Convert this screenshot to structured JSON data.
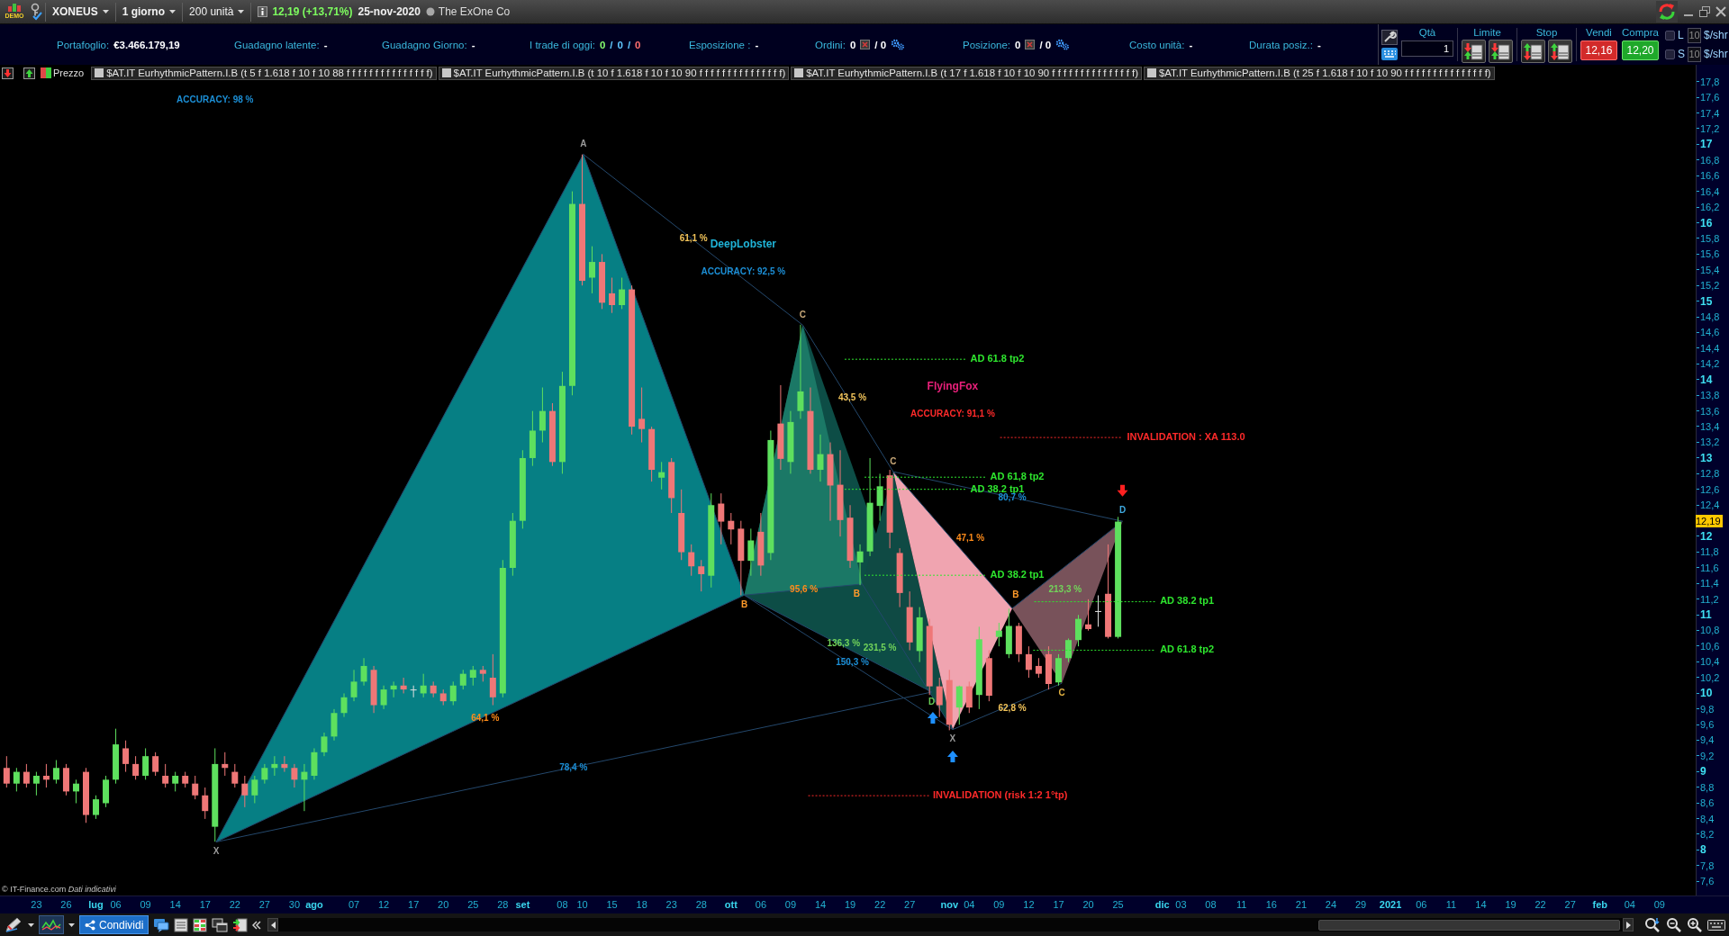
{
  "title_bar": {
    "demo_badge": "DEMO",
    "symbol": "XONEUS",
    "timeframe": "1 giorno",
    "units": "200 unità",
    "quote": "12,19 (+13,71%)",
    "date": "25-nov-2020",
    "company": "The ExOne Co"
  },
  "account_bar": {
    "stats": [
      {
        "kind": "value",
        "label": "Portafoglio:",
        "value": "€3.466.179,19"
      },
      {
        "kind": "value",
        "label": "Guadagno latente:",
        "value": "-"
      },
      {
        "kind": "value",
        "label": "Guadagno Giorno:",
        "value": "-"
      },
      {
        "kind": "counts",
        "label": "I trade di oggi:",
        "parts": [
          {
            "text": "0",
            "color": "#86ff6e"
          },
          {
            "text": "/",
            "color": "#5fc8ff"
          },
          {
            "text": "0",
            "color": "#5fc8ff"
          },
          {
            "text": "/",
            "color": "#5fc8ff"
          },
          {
            "text": "0",
            "color": "#ff6e6e"
          }
        ]
      },
      {
        "kind": "value",
        "label": "Esposizione :",
        "value": "-"
      },
      {
        "kind": "orders",
        "label": "Ordini:",
        "value": "0",
        "value_2": "/ 0"
      },
      {
        "kind": "orders",
        "label": "Posizione:",
        "value": "0",
        "value_2": "/ 0"
      },
      {
        "kind": "value",
        "label": "Costo unità:",
        "value": "-"
      },
      {
        "kind": "value",
        "label": "Durata posiz.:",
        "value": "-"
      }
    ]
  },
  "trade_panel": {
    "quantity": {
      "label": "Qtà",
      "value": "1"
    },
    "limit": {
      "label": "Limite"
    },
    "stop": {
      "label": "Stop"
    },
    "sell": {
      "label": "Vendi",
      "price": "12,16"
    },
    "buy": {
      "label": "Compra",
      "price": "12,20"
    },
    "sides": [
      {
        "label": "L",
        "checked": false,
        "amount": "10",
        "unit": "$/shr"
      },
      {
        "label": "S",
        "checked": false,
        "amount": "10",
        "unit": "$/shr"
      }
    ]
  },
  "legend": {
    "price": "Prezzo",
    "indicators": [
      "$AT.IT EurhythmicPattern.I.B (t 5 f 1.618 f 10 f 10 88 f f f f f f f f f f f f f f f)",
      "$AT.IT EurhythmicPattern.I.B (t 10 f 1.618 f 10 f 10 90 f f f f f f f f f f f f f f f)",
      "$AT.IT EurhythmicPattern.I.B (t 17 f 1.618 f 10 f 10 90 f f f f f f f f f f f f f f f)",
      "$AT.IT EurhythmicPattern.I.B (t 25 f 1.618 f 10 f 10 90 f f f f f f f f f f f f f f f)"
    ]
  },
  "chart": {
    "annotations": [
      {
        "text": "ACCURACY: 98 %",
        "kind": "label",
        "color": "#1c8fd6"
      },
      {
        "text": "61,1 %",
        "kind": "label",
        "color": "#f2c45a"
      },
      {
        "text": "DeepLobster",
        "kind": "title",
        "color": "#1fb4d8"
      },
      {
        "text": "ACCURACY: 92,5 %",
        "kind": "label",
        "color": "#1c8fd6"
      },
      {
        "text": "AD 61.8 tp2",
        "kind": "level",
        "color": "#2ee62e"
      },
      {
        "text": "FlyingFox",
        "kind": "title",
        "color": "#e8207a"
      },
      {
        "text": "43,5 %",
        "kind": "label",
        "color": "#f2c45a"
      },
      {
        "text": "ACCURACY: 91,1 %",
        "kind": "label",
        "color": "#ff2a2a"
      },
      {
        "text": "INVALIDATION : XA 113.0",
        "kind": "level",
        "color": "#ff2a2a"
      },
      {
        "text": "AD 61,8 tp2",
        "kind": "level",
        "color": "#2ee62e"
      },
      {
        "text": "AD 38.2 tp1",
        "kind": "level",
        "color": "#2ee62e"
      },
      {
        "text": "80,7 %",
        "kind": "label",
        "color": "#1c8fd6"
      },
      {
        "text": "47,1 %",
        "kind": "label",
        "color": "#ff8c1a"
      },
      {
        "text": "213,3 %",
        "kind": "label",
        "color": "#72d45a"
      },
      {
        "text": "AD 38.2 tp1",
        "kind": "level",
        "color": "#2ee62e"
      },
      {
        "text": "95,6 %",
        "kind": "label",
        "color": "#ff8c1a"
      },
      {
        "text": "AD 38.2 tp1",
        "kind": "level",
        "color": "#2ee62e"
      },
      {
        "text": "136,3 %",
        "kind": "label",
        "color": "#72d45a"
      },
      {
        "text": "AD 61.8 tp2",
        "kind": "level",
        "color": "#2ee62e"
      },
      {
        "text": "231,5 %",
        "kind": "label",
        "color": "#72d45a"
      },
      {
        "text": "150,3 %",
        "kind": "label",
        "color": "#1c8fd6"
      },
      {
        "text": "62,8 %",
        "kind": "label",
        "color": "#f2c45a"
      },
      {
        "text": "64,1 %",
        "kind": "label",
        "color": "#ff8c1a"
      },
      {
        "text": "78,4 %",
        "kind": "label",
        "color": "#1c8fd6"
      },
      {
        "text": "INVALIDATION (risk 1:2 1°tp)",
        "kind": "level",
        "color": "#ff2a2a"
      }
    ],
    "points": [
      {
        "label": "X",
        "color": "#9a9a9a"
      },
      {
        "label": "A",
        "color": "#9a9a9a"
      },
      {
        "label": "B",
        "color": "#ff9a2a"
      },
      {
        "label": "C",
        "color": "#c8a878"
      },
      {
        "label": "B",
        "color": "#ff9a2a"
      },
      {
        "label": "C",
        "color": "#c8a878"
      },
      {
        "label": "D",
        "color": "#66cc55"
      },
      {
        "label": "X",
        "color": "#9a9a9a"
      },
      {
        "label": "B",
        "color": "#ff9a2a"
      },
      {
        "label": "C",
        "color": "#e0b040"
      },
      {
        "label": "D",
        "color": "#3fa9e0"
      }
    ],
    "source": "© IT-Finance.com *Dati indicativi*"
  },
  "price_axis": [
    {
      "label": "17,8",
      "kind": "minor"
    },
    {
      "label": "17,6",
      "kind": "minor"
    },
    {
      "label": "17,4",
      "kind": "minor"
    },
    {
      "label": "17,2",
      "kind": "minor"
    },
    {
      "label": "17",
      "kind": "major"
    },
    {
      "label": "16,8",
      "kind": "minor"
    },
    {
      "label": "16,6",
      "kind": "minor"
    },
    {
      "label": "16,4",
      "kind": "minor"
    },
    {
      "label": "16,2",
      "kind": "minor"
    },
    {
      "label": "16",
      "kind": "major"
    },
    {
      "label": "15,8",
      "kind": "minor"
    },
    {
      "label": "15,6",
      "kind": "minor"
    },
    {
      "label": "15,4",
      "kind": "minor"
    },
    {
      "label": "15,2",
      "kind": "minor"
    },
    {
      "label": "15",
      "kind": "major"
    },
    {
      "label": "14,8",
      "kind": "minor"
    },
    {
      "label": "14,6",
      "kind": "minor"
    },
    {
      "label": "14,4",
      "kind": "minor"
    },
    {
      "label": "14,2",
      "kind": "minor"
    },
    {
      "label": "14",
      "kind": "major"
    },
    {
      "label": "13,8",
      "kind": "minor"
    },
    {
      "label": "13,6",
      "kind": "minor"
    },
    {
      "label": "13,4",
      "kind": "minor"
    },
    {
      "label": "13,2",
      "kind": "minor"
    },
    {
      "label": "13",
      "kind": "major"
    },
    {
      "label": "12,8",
      "kind": "minor"
    },
    {
      "label": "12,6",
      "kind": "minor"
    },
    {
      "label": "12,4",
      "kind": "minor"
    },
    {
      "label": "12,19",
      "kind": "current"
    },
    {
      "label": "12",
      "kind": "major"
    },
    {
      "label": "11,8",
      "kind": "minor"
    },
    {
      "label": "11,6",
      "kind": "minor"
    },
    {
      "label": "11,4",
      "kind": "minor"
    },
    {
      "label": "11,2",
      "kind": "minor"
    },
    {
      "label": "11",
      "kind": "major"
    },
    {
      "label": "10,8",
      "kind": "minor"
    },
    {
      "label": "10,6",
      "kind": "minor"
    },
    {
      "label": "10,4",
      "kind": "minor"
    },
    {
      "label": "10,2",
      "kind": "minor"
    },
    {
      "label": "10",
      "kind": "major"
    },
    {
      "label": "9,8",
      "kind": "minor"
    },
    {
      "label": "9,6",
      "kind": "minor"
    },
    {
      "label": "9,4",
      "kind": "minor"
    },
    {
      "label": "9,2",
      "kind": "minor"
    },
    {
      "label": "9",
      "kind": "major"
    },
    {
      "label": "8,8",
      "kind": "minor"
    },
    {
      "label": "8,6",
      "kind": "minor"
    },
    {
      "label": "8,4",
      "kind": "minor"
    },
    {
      "label": "8,2",
      "kind": "minor"
    },
    {
      "label": "8",
      "kind": "major"
    },
    {
      "label": "7,8",
      "kind": "minor"
    },
    {
      "label": "7,6",
      "kind": "minor"
    }
  ],
  "date_axis": [
    {
      "label": "23",
      "kind": "day"
    },
    {
      "label": "26",
      "kind": "day"
    },
    {
      "label": "lug",
      "kind": "month"
    },
    {
      "label": "06",
      "kind": "day"
    },
    {
      "label": "09",
      "kind": "day"
    },
    {
      "label": "14",
      "kind": "day"
    },
    {
      "label": "17",
      "kind": "day"
    },
    {
      "label": "22",
      "kind": "day"
    },
    {
      "label": "27",
      "kind": "day"
    },
    {
      "label": "30",
      "kind": "day"
    },
    {
      "label": "ago",
      "kind": "month"
    },
    {
      "label": "07",
      "kind": "day"
    },
    {
      "label": "12",
      "kind": "day"
    },
    {
      "label": "17",
      "kind": "day"
    },
    {
      "label": "20",
      "kind": "day"
    },
    {
      "label": "25",
      "kind": "day"
    },
    {
      "label": "28",
      "kind": "day"
    },
    {
      "label": "set",
      "kind": "month"
    },
    {
      "label": "08",
      "kind": "day"
    },
    {
      "label": "10",
      "kind": "day"
    },
    {
      "label": "15",
      "kind": "day"
    },
    {
      "label": "18",
      "kind": "day"
    },
    {
      "label": "23",
      "kind": "day"
    },
    {
      "label": "28",
      "kind": "day"
    },
    {
      "label": "ott",
      "kind": "month"
    },
    {
      "label": "06",
      "kind": "day"
    },
    {
      "label": "09",
      "kind": "day"
    },
    {
      "label": "14",
      "kind": "day"
    },
    {
      "label": "19",
      "kind": "day"
    },
    {
      "label": "22",
      "kind": "day"
    },
    {
      "label": "27",
      "kind": "day"
    },
    {
      "label": "nov",
      "kind": "month"
    },
    {
      "label": "04",
      "kind": "day"
    },
    {
      "label": "09",
      "kind": "day"
    },
    {
      "label": "12",
      "kind": "day"
    },
    {
      "label": "17",
      "kind": "day"
    },
    {
      "label": "20",
      "kind": "day"
    },
    {
      "label": "25",
      "kind": "day"
    },
    {
      "label": "dic",
      "kind": "month"
    },
    {
      "label": "03",
      "kind": "day"
    },
    {
      "label": "08",
      "kind": "day"
    },
    {
      "label": "11",
      "kind": "day"
    },
    {
      "label": "16",
      "kind": "day"
    },
    {
      "label": "21",
      "kind": "day"
    },
    {
      "label": "24",
      "kind": "day"
    },
    {
      "label": "29",
      "kind": "day"
    },
    {
      "label": "2021",
      "kind": "month"
    },
    {
      "label": "06",
      "kind": "day"
    },
    {
      "label": "11",
      "kind": "day"
    },
    {
      "label": "14",
      "kind": "day"
    },
    {
      "label": "19",
      "kind": "day"
    },
    {
      "label": "22",
      "kind": "day"
    },
    {
      "label": "27",
      "kind": "day"
    },
    {
      "label": "feb",
      "kind": "month"
    },
    {
      "label": "04",
      "kind": "day"
    },
    {
      "label": "09",
      "kind": "day"
    }
  ],
  "toolbar": {
    "share": "Condividi"
  }
}
